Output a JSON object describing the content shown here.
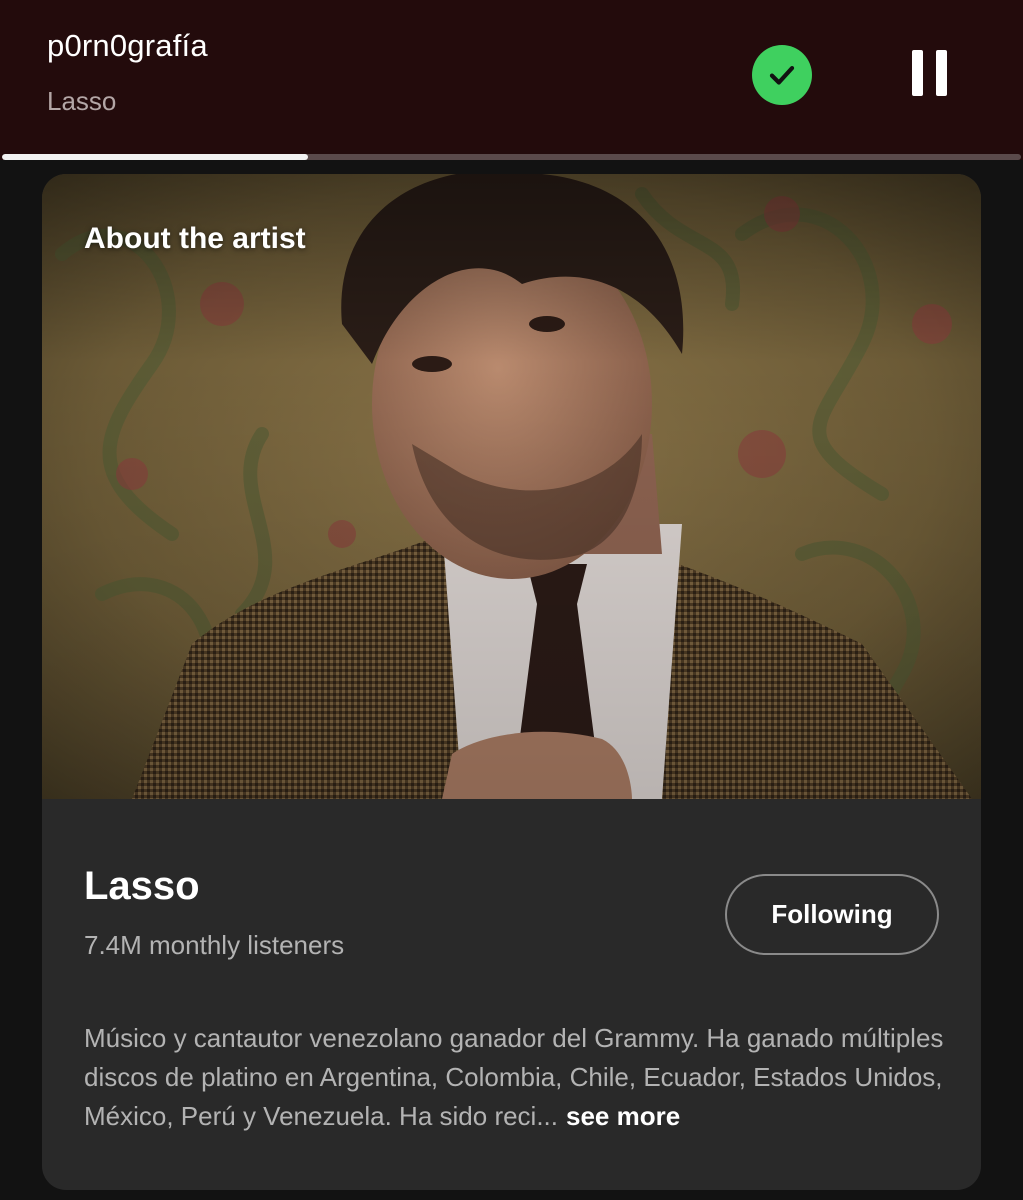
{
  "player": {
    "track_title": "p0rn0grafía",
    "track_artist": "Lasso",
    "liked": true,
    "progress": 0.3,
    "accent_color": "#3fd05f",
    "background_color": "#230b0c"
  },
  "about": {
    "heading": "About the artist",
    "artist_name": "Lasso",
    "monthly_listeners": "7.4M monthly listeners",
    "follow_label": "Following",
    "bio": "Músico y cantautor venezolano ganador del Grammy. Ha ganado múltiples discos de platino en Argentina, Colombia, Chile, Ecuador, Estados Unidos, México, Perú y Venezuela. Ha sido reci...",
    "see_more_label": "see more"
  },
  "icons": {
    "liked": "check-icon",
    "playback": "pause-icon"
  }
}
